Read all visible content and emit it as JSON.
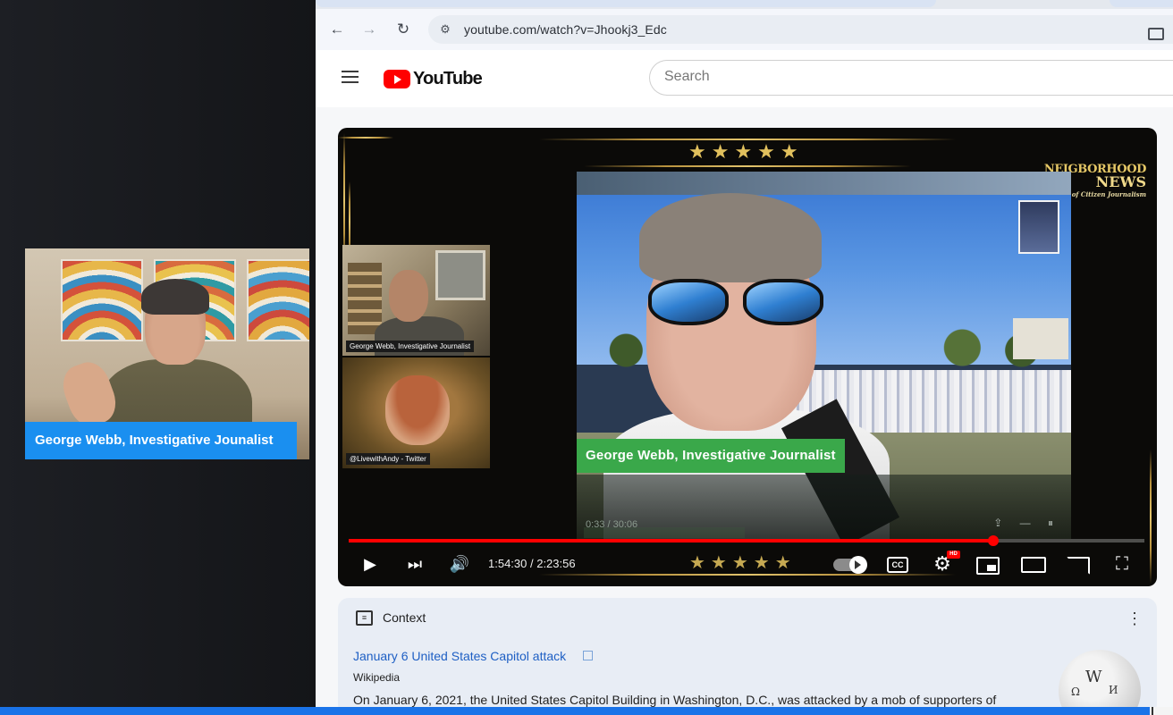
{
  "presenter": {
    "lower_third": "George Webb, Investigative Jounalist"
  },
  "browser": {
    "url": "youtube.com/watch?v=Jhookj3_Edc",
    "icons": [
      "back-arrow-icon",
      "forward-arrow-icon",
      "reload-icon",
      "site-settings-icon",
      "install-app-icon"
    ]
  },
  "youtube": {
    "logo_text": "YouTube",
    "search_placeholder": "Search",
    "colors": {
      "brand_red": "#ff0000",
      "link_blue": "#1e5fc4",
      "accent_blue": "#1a73e8",
      "lower_third_green": "#3aa84a",
      "gold": "#e1c05d"
    }
  },
  "video": {
    "stars": "★★★★★",
    "logo_line1": "NEIGBORHOOD",
    "logo_line2": "NEWS",
    "logo_tagline": "Home of Citizen Journalism",
    "side_cam1_tag": "George Webb, Investigative Journalist",
    "side_cam2_tag": "@LivewithAndy - Twitter",
    "main_lower_third": "George Webb, Investigative Journalist",
    "inner_time": "0:33 / 30:06",
    "progress_fraction": 0.81,
    "time_display": "1:54:30 / 2:23:56",
    "controls": [
      "play-icon",
      "next-icon",
      "volume-icon",
      "autoplay-toggle",
      "captions-icon",
      "settings-icon",
      "miniplayer-icon",
      "theater-icon",
      "cast-icon",
      "fullscreen-icon"
    ],
    "cc_label": "CC",
    "hd_badge": "HD"
  },
  "context": {
    "title": "Context",
    "link": "January 6 United States Capitol attack",
    "source": "Wikipedia",
    "description": "On January 6, 2021, the United States Capitol Building in Washington, D.C., was attacked by a mob of supporters of"
  }
}
